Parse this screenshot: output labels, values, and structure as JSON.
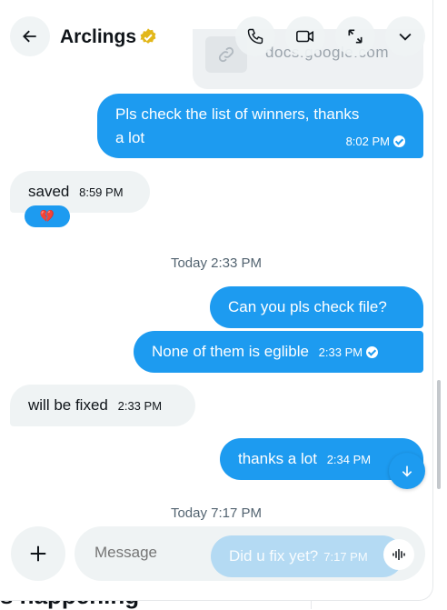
{
  "header": {
    "back_icon": "arrow-left-icon",
    "title": "Arclings",
    "verified_icon": "verified-gold-badge-icon",
    "actions": [
      "phone-icon",
      "video-icon",
      "expand-icon",
      "chevron-down-icon"
    ]
  },
  "link_preview": {
    "domain": "docs.google.com",
    "icon": "link-icon"
  },
  "messages": [
    {
      "direction": "out",
      "text_line1": "Pls check the list of winners, thanks",
      "text_line2": "a lot",
      "time": "8:02 PM",
      "seen": true
    },
    {
      "direction": "in",
      "text": "saved",
      "time": "8:59 PM",
      "reaction": "💔"
    },
    {
      "direction": "out",
      "text": "Can you pls check file?"
    },
    {
      "direction": "out",
      "text": "None of them is eglible",
      "time": "2:33 PM",
      "seen": true
    },
    {
      "direction": "in",
      "text": "will be fixed",
      "time": "2:33 PM"
    },
    {
      "direction": "out",
      "text": "thanks a lot",
      "time": "2:34 PM"
    }
  ],
  "separators": {
    "first": "Today 2:33 PM",
    "second": "Today 7:17 PM"
  },
  "composer": {
    "placeholder": "Message",
    "pending_text": "Did u fix yet?",
    "pending_time": "7:17 PM",
    "add_icon": "plus-icon",
    "voice_icon": "voice-waveform-icon"
  },
  "scroll_down_icon": "arrow-down-icon",
  "background_text": "s happening",
  "colors": {
    "accent": "#1d9bf0",
    "incoming": "#eff3f4",
    "text": "#0f1419",
    "muted": "#536471"
  }
}
